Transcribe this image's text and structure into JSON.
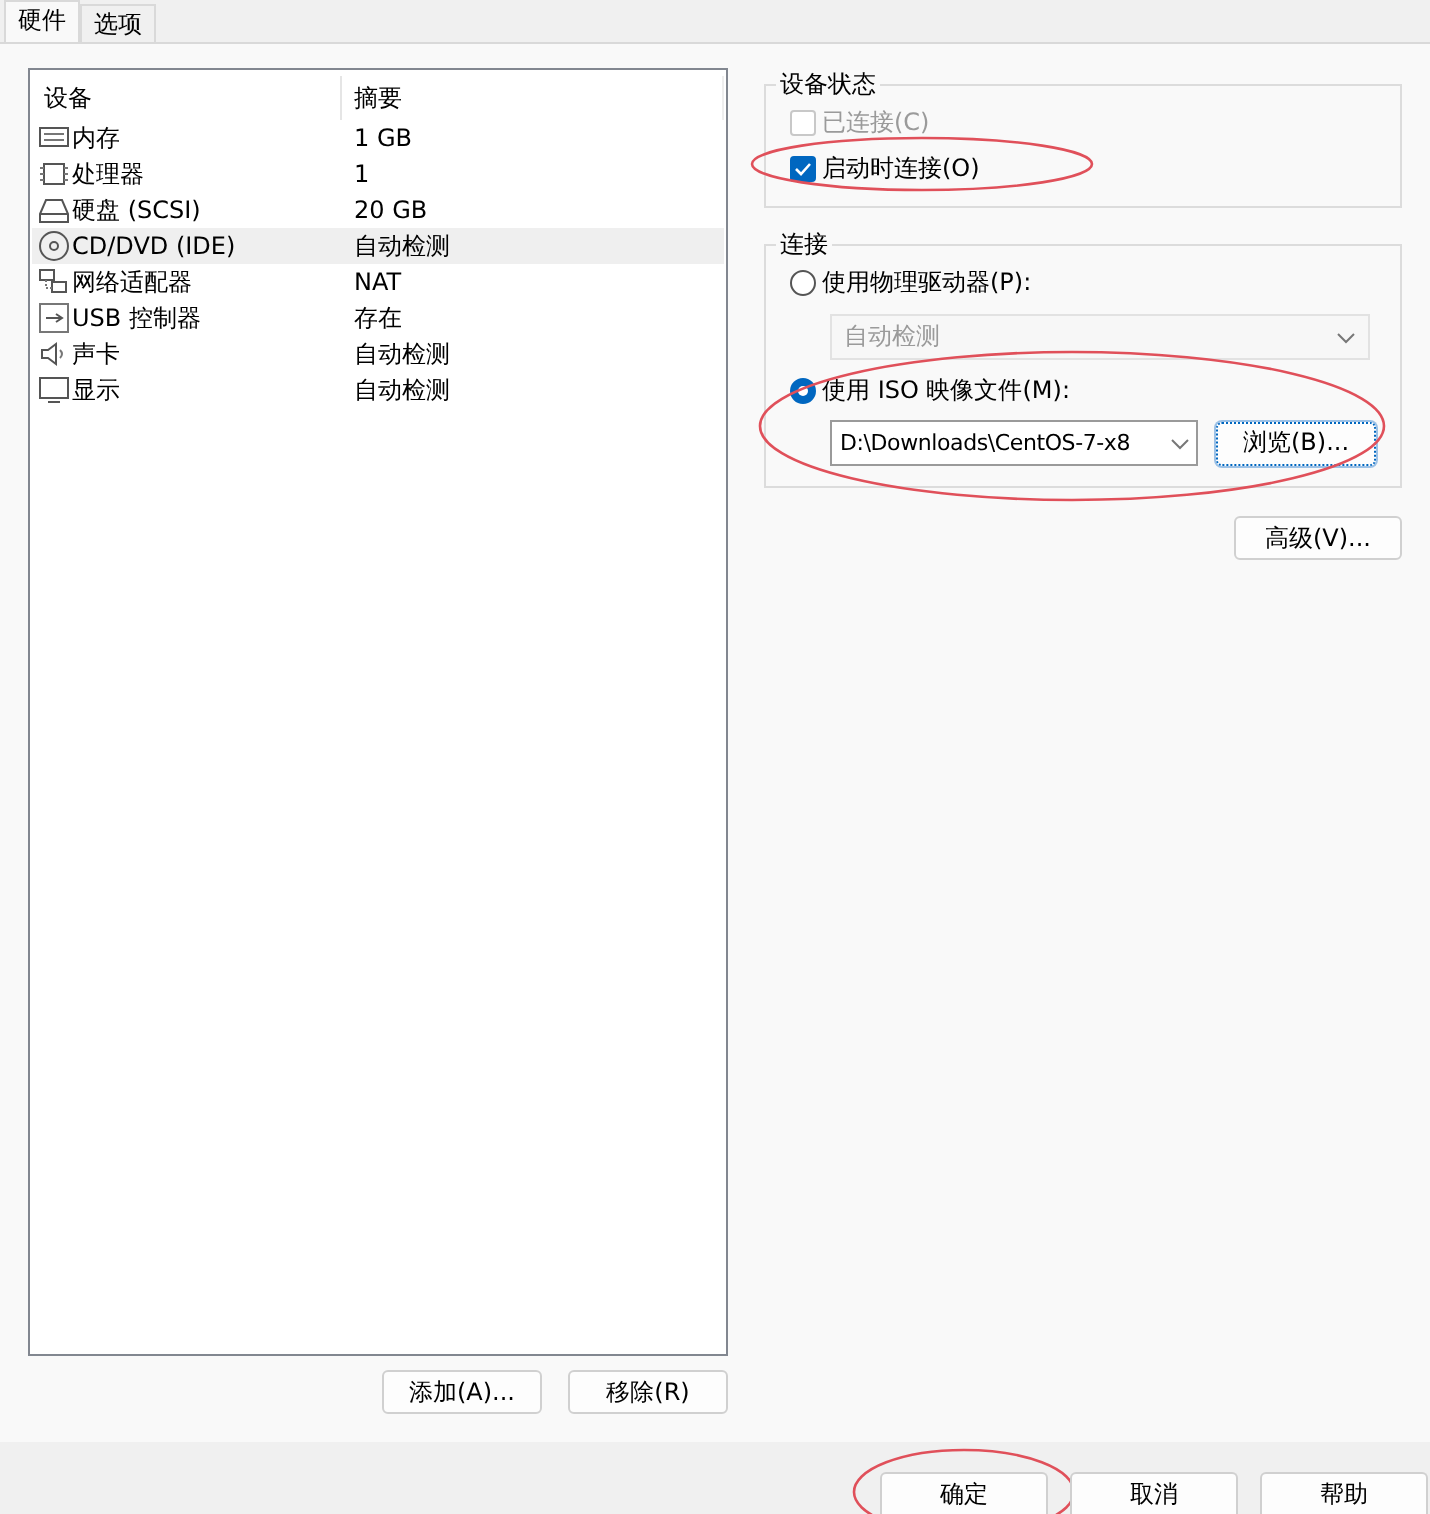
{
  "tabs": [
    {
      "label": "硬件",
      "selected": true
    },
    {
      "label": "选项",
      "selected": false
    }
  ],
  "devices": {
    "columns": [
      "设备",
      "摘要"
    ],
    "rows": [
      {
        "kind": "memory",
        "name": "内存",
        "summary": "1 GB",
        "selected": false
      },
      {
        "kind": "cpu",
        "name": "处理器",
        "summary": "1",
        "selected": false
      },
      {
        "kind": "disk",
        "name": "硬盘 (SCSI)",
        "summary": "20 GB",
        "selected": false
      },
      {
        "kind": "cd",
        "name": "CD/DVD (IDE)",
        "summary": "自动检测",
        "selected": true
      },
      {
        "kind": "network",
        "name": "网络适配器",
        "summary": "NAT",
        "selected": false
      },
      {
        "kind": "usb",
        "name": "USB 控制器",
        "summary": "存在",
        "selected": false
      },
      {
        "kind": "sound",
        "name": "声卡",
        "summary": "自动检测",
        "selected": false
      },
      {
        "kind": "display",
        "name": "显示",
        "summary": "自动检测",
        "selected": false
      }
    ]
  },
  "device_buttons": [
    "添加(A)...",
    "移除(R)"
  ],
  "device_status": {
    "title": "设备状态",
    "options": [
      {
        "label": "已连接(C)",
        "checked": false,
        "disabled": true,
        "highlight": false
      },
      {
        "label": "启动时连接(O)",
        "checked": true,
        "disabled": false,
        "highlight": true
      }
    ]
  },
  "connection": {
    "title": "连接",
    "highlight": true,
    "physical": {
      "label": "使用物理驱动器(P):",
      "selected": false,
      "drive": "自动检测",
      "disabled": true
    },
    "iso": {
      "label": "使用 ISO 映像文件(M):",
      "selected": true,
      "path": "D:\\Downloads\\CentOS-7-x8",
      "browse": "浏览(B)..."
    }
  },
  "advanced_button": "高级(V)...",
  "dialog_buttons": [
    {
      "label": "确定",
      "highlight": true
    },
    {
      "label": "取消",
      "highlight": false
    },
    {
      "label": "帮助",
      "highlight": false
    }
  ]
}
